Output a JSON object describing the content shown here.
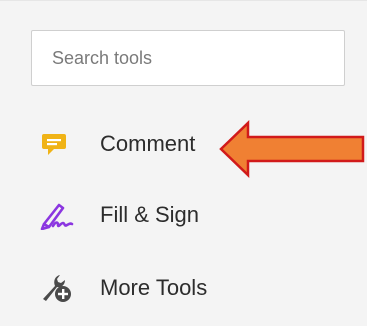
{
  "search": {
    "placeholder": "Search tools"
  },
  "tools": [
    {
      "label": "Comment",
      "icon": "comment-icon",
      "color": "#f0b316"
    },
    {
      "label": "Fill & Sign",
      "icon": "fill-sign-icon",
      "color": "#8b36e0"
    },
    {
      "label": "More Tools",
      "icon": "wrench-plus-icon",
      "color": "#4a4a4a"
    }
  ],
  "annotation": {
    "icon": "callout-arrow",
    "fill": "#f08033",
    "stroke": "#d11a1a"
  }
}
